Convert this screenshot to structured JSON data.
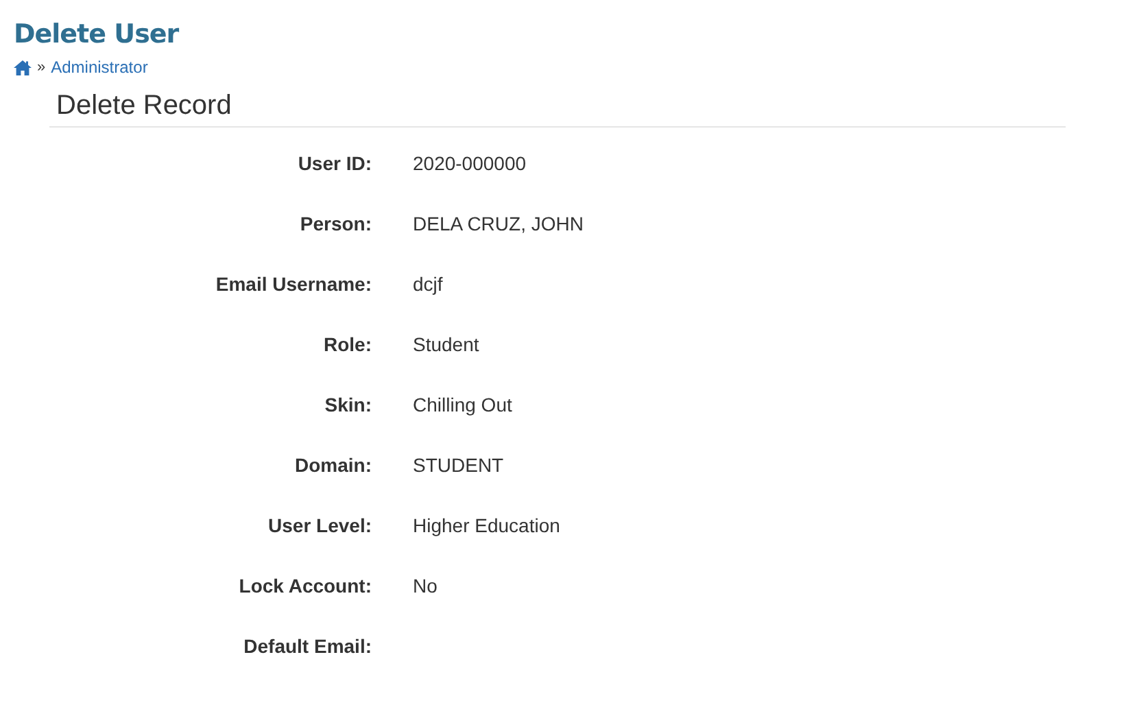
{
  "page_title": "Delete User",
  "breadcrumb": {
    "separator": "»",
    "items": [
      "Administrator"
    ]
  },
  "section_title": "Delete Record",
  "fields": [
    {
      "label": "User ID:",
      "value": "2020-000000"
    },
    {
      "label": "Person:",
      "value": "DELA CRUZ, JOHN"
    },
    {
      "label": "Email Username:",
      "value": "dcjf"
    },
    {
      "label": "Role:",
      "value": "Student"
    },
    {
      "label": "Skin:",
      "value": "Chilling Out"
    },
    {
      "label": "Domain:",
      "value": "STUDENT"
    },
    {
      "label": "User Level:",
      "value": "Higher Education"
    },
    {
      "label": "Lock Account:",
      "value": "No"
    },
    {
      "label": "Default Email:"
    }
  ]
}
